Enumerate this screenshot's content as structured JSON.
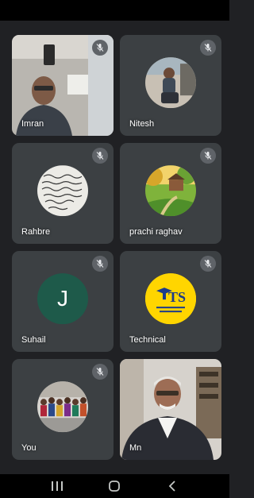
{
  "participants": [
    {
      "name": "Imran",
      "type": "video",
      "muted": true
    },
    {
      "name": "Nitesh",
      "type": "avatar-photo",
      "muted": true,
      "avatar_icon": "person-outdoor-photo"
    },
    {
      "name": "Rahbre",
      "type": "avatar-photo",
      "muted": true,
      "avatar_icon": "handwritten-text-image"
    },
    {
      "name": "prachi raghav",
      "type": "avatar-photo",
      "muted": true,
      "avatar_icon": "garden-landscape-image"
    },
    {
      "name": "Suhail",
      "type": "avatar-letter",
      "muted": true,
      "initial": "J",
      "avatar_color": "#1e5a4a"
    },
    {
      "name": "Technical",
      "type": "avatar-logo",
      "muted": true,
      "logo_text": "TS",
      "avatar_color": "#ffd500"
    },
    {
      "name": "You",
      "type": "avatar-photo",
      "muted": true,
      "avatar_icon": "group-photo"
    },
    {
      "name": "Mn",
      "type": "video",
      "muted": false
    }
  ],
  "navigation": {
    "recents_icon": "recents-icon",
    "home_icon": "home-icon",
    "back_icon": "back-icon"
  },
  "colors": {
    "background": "#202124",
    "tile": "#3c4043",
    "mute_badge": "#5f6368"
  }
}
